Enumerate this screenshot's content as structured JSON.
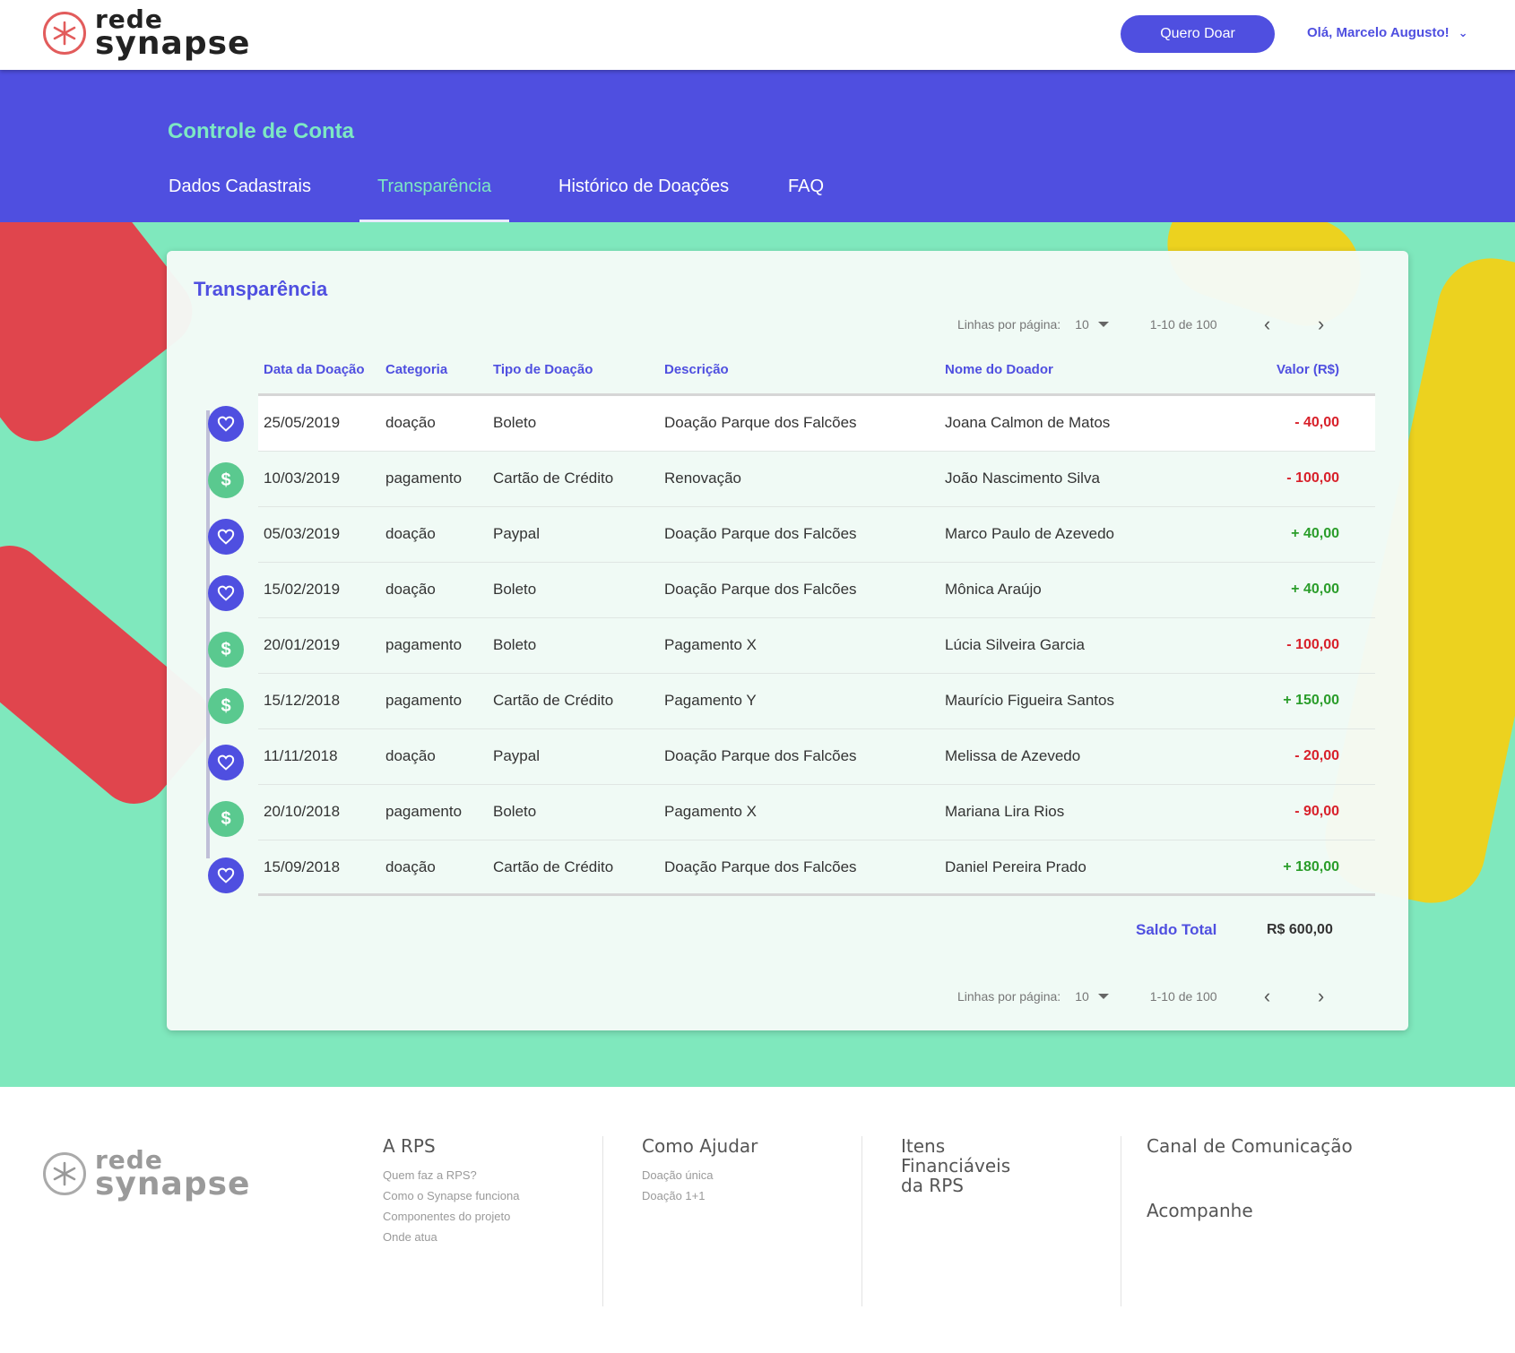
{
  "header": {
    "logo_line1": "rede",
    "logo_line2": "synapse",
    "donate_label": "Quero Doar",
    "user_greeting": "Olá, Marcelo Augusto!"
  },
  "band": {
    "title": "Controle de Conta",
    "tabs": [
      "Dados Cadastrais",
      "Transparência",
      "Histórico de Doações",
      "FAQ"
    ],
    "active_tab": "Transparência"
  },
  "card": {
    "title": "Transparência",
    "pager": {
      "rows_label": "Linhas por página:",
      "rows_value": "10",
      "range": "1-10 de 100",
      "prev_icon": "chevron-left",
      "next_icon": "chevron-right"
    },
    "columns": [
      "Data da Doação",
      "Categoria",
      "Tipo de Doação",
      "Descrição",
      "Nome do Doador",
      "Valor (R$)"
    ],
    "rows": [
      {
        "icon": "heart",
        "date": "25/05/2019",
        "category": "doação",
        "type": "Boleto",
        "description": "Doação Parque dos Falcões",
        "donor": "Joana Calmon de Matos",
        "value": "- 40,00",
        "sign": "neg"
      },
      {
        "icon": "dollar",
        "date": "10/03/2019",
        "category": "pagamento",
        "type": "Cartão de Crédito",
        "description": "Renovação",
        "donor": "João Nascimento Silva",
        "value": "- 100,00",
        "sign": "neg"
      },
      {
        "icon": "heart",
        "date": "05/03/2019",
        "category": "doação",
        "type": "Paypal",
        "description": "Doação Parque dos Falcões",
        "donor": "Marco Paulo de Azevedo",
        "value": "+ 40,00",
        "sign": "pos"
      },
      {
        "icon": "heart",
        "date": "15/02/2019",
        "category": "doação",
        "type": "Boleto",
        "description": "Doação Parque dos Falcões",
        "donor": "Mônica Araújo",
        "value": "+ 40,00",
        "sign": "pos"
      },
      {
        "icon": "dollar",
        "date": "20/01/2019",
        "category": "pagamento",
        "type": "Boleto",
        "description": "Pagamento X",
        "donor": "Lúcia Silveira Garcia",
        "value": "- 100,00",
        "sign": "neg"
      },
      {
        "icon": "dollar",
        "date": "15/12/2018",
        "category": "pagamento",
        "type": "Cartão de Crédito",
        "description": "Pagamento Y",
        "donor": "Maurício Figueira Santos",
        "value": "+ 150,00",
        "sign": "pos"
      },
      {
        "icon": "heart",
        "date": "11/11/2018",
        "category": "doação",
        "type": "Paypal",
        "description": "Doação Parque dos Falcões",
        "donor": "Melissa de Azevedo",
        "value": "- 20,00",
        "sign": "neg"
      },
      {
        "icon": "dollar",
        "date": "20/10/2018",
        "category": "pagamento",
        "type": "Boleto",
        "description": "Pagamento X",
        "donor": "Mariana Lira Rios",
        "value": "- 90,00",
        "sign": "neg"
      },
      {
        "icon": "heart",
        "date": "15/09/2018",
        "category": "doação",
        "type": "Cartão de Crédito",
        "description": "Doação Parque dos Falcões",
        "donor": "Daniel Pereira Prado",
        "value": "+ 180,00",
        "sign": "pos"
      }
    ],
    "total_label": "Saldo Total",
    "total_value": "R$ 600,00"
  },
  "footer": {
    "logo_line1": "rede",
    "logo_line2": "synapse",
    "col1": {
      "title": "A RPS",
      "links": [
        "Quem faz a RPS?",
        "Como o Synapse funciona",
        "Componentes do projeto",
        "Onde atua"
      ]
    },
    "col2": {
      "title": "Como Ajudar",
      "links": [
        "Doação única",
        "Doação 1+1"
      ]
    },
    "col3": {
      "title_line1": "Itens",
      "title_line2": "Financiáveis",
      "title_line3": "da RPS"
    },
    "col4": {
      "title": "Canal de Comunicação",
      "subtitle": "Acompanhe"
    }
  },
  "colors": {
    "brand_purple": "#4f4fe0",
    "mint": "#7fe8bd",
    "negative": "#d8202a",
    "positive": "#2a9d2a",
    "dollar_icon": "#5ac98f"
  }
}
